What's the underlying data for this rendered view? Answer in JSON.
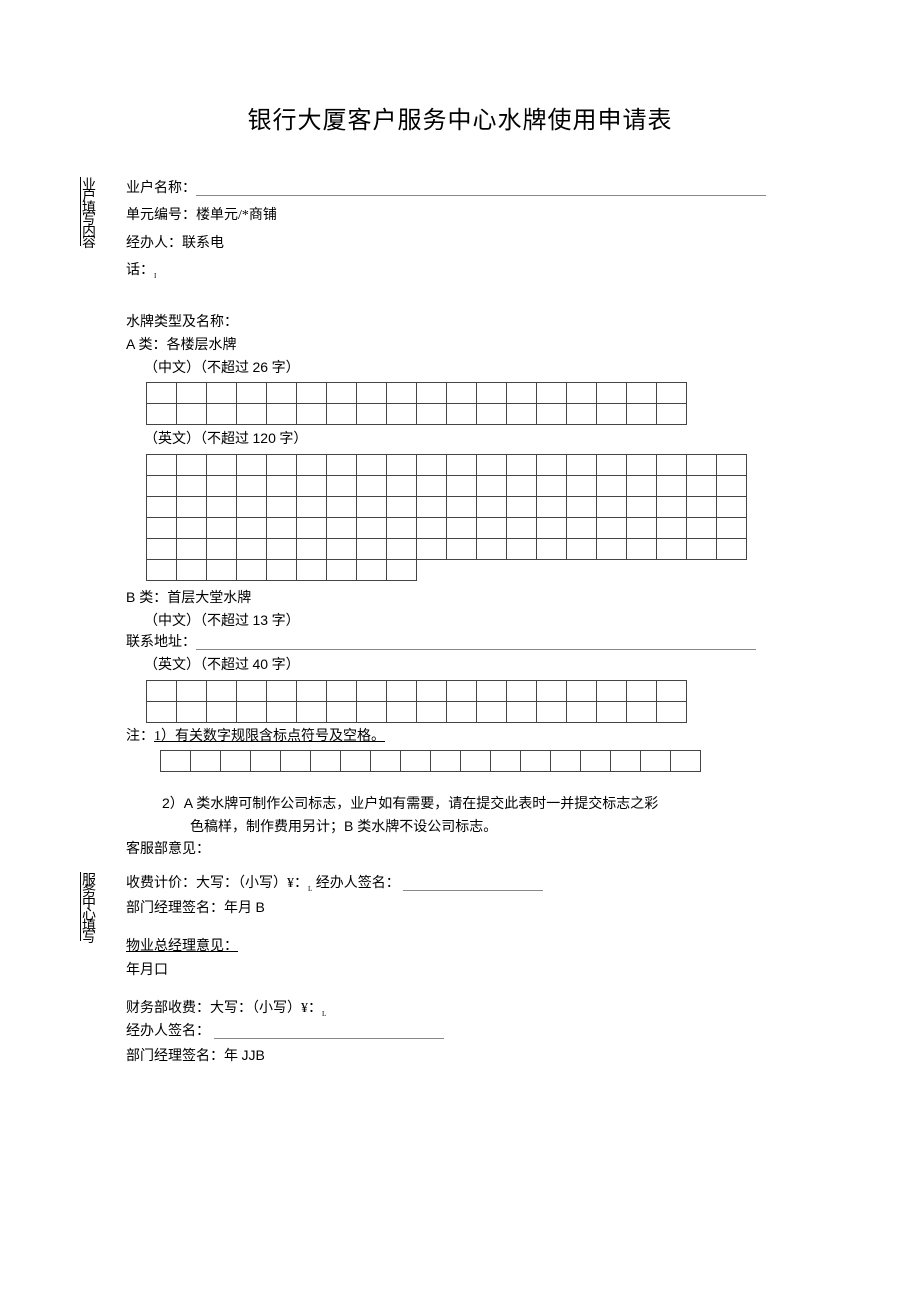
{
  "title": "银行大厦客户服务中心水牌使用申请表",
  "vlabel_owner": "业户填写内容",
  "field_owner_name": "业户名称：",
  "field_unit_no": "单元编号：楼单元/*商铺",
  "field_agent": "经办人：联系电",
  "field_phone": "话：",
  "sign_type_header": "水牌类型及名称：",
  "type_a_header": "A 类：各楼层水牌",
  "chinese_limit_26": "（中文）（不超过 26 字）",
  "english_limit_120": "（英文）（不超过 120 字）",
  "type_b_header": "B 类：首层大堂水牌",
  "chinese_limit_13": "（中文）（不超过 13 字）",
  "contact_addr": "联系地址：",
  "english_limit_40": "（英文）（不超过 40 字）",
  "note1": "注：1）有关数字规限含标点符号及空格。",
  "note2_a": "2）A 类水牌可制作公司标志，业户如有需要，请在提交此表时一并提交标志之彩",
  "note2_b": "色稿样，制作费用另计；B 类水牌不设公司标志。",
  "cs_opinion": "客服部意见：",
  "charge_line_a": "收费计价：大写：（小写）¥：",
  "agent_sign": "经办人签名：",
  "dept_mgr_sign_a": "部门经理签名：年月 B",
  "vlabel_service": "服务中心填写",
  "pm_opinion": "物业总经理意见：",
  "ymd": "年月口",
  "finance_line": "财务部收费：大写：（小写）¥：",
  "agent_sign2": "经办人签名：",
  "dept_mgr_sign_b": "部门经理签名：年 JJB",
  "sub_i": "I",
  "sub_l": "L"
}
